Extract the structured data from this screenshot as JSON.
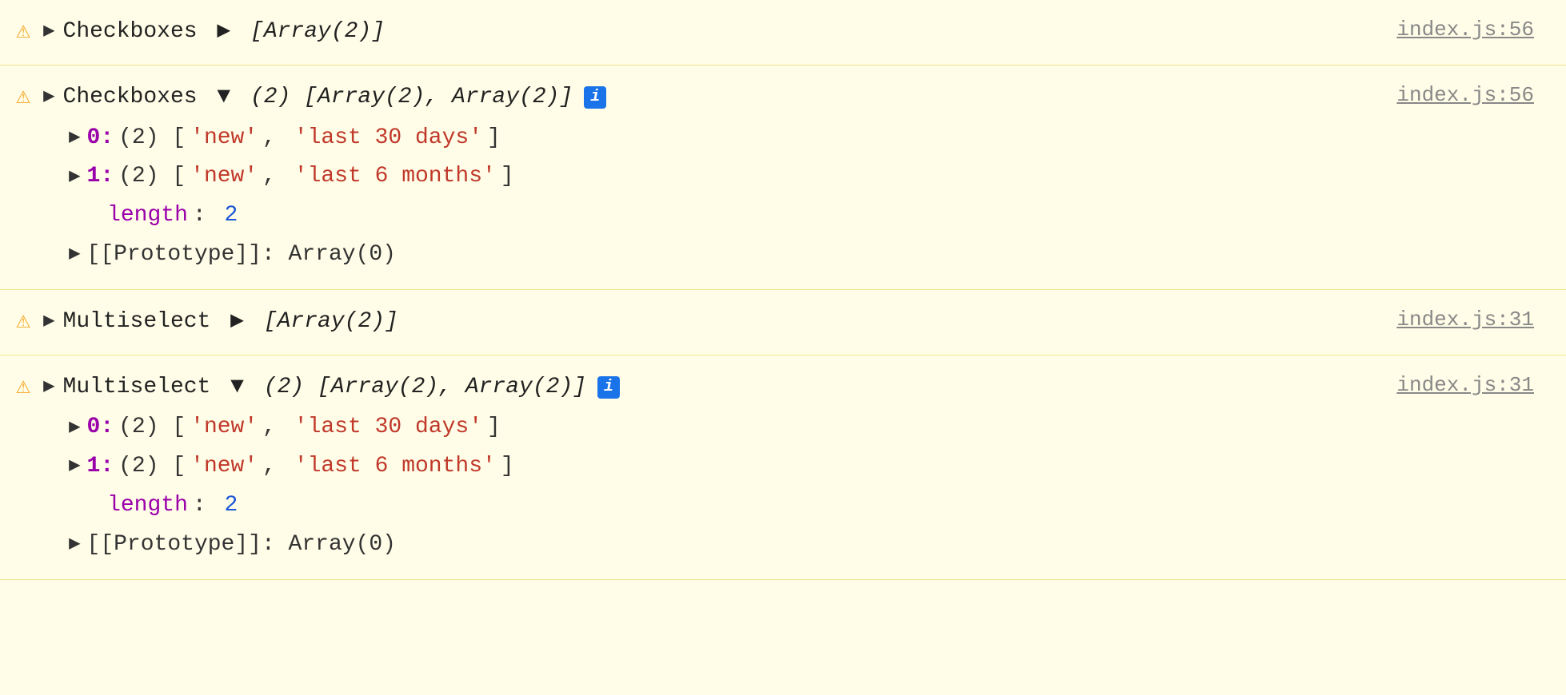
{
  "console": {
    "entries": [
      {
        "id": "entry-1",
        "hasWarning": true,
        "expanded": false,
        "label": "Checkboxes",
        "arrow": "▶",
        "arrayText": "[Array(2)]",
        "italic": true,
        "fileLink": "index.js:56"
      },
      {
        "id": "entry-2",
        "hasWarning": true,
        "expanded": true,
        "label": "Checkboxes",
        "arrow": "▼",
        "arrayCountText": "(2) [Array(2), Array(2)]",
        "italic": true,
        "hasInfoBadge": true,
        "fileLink": "index.js:56",
        "children": [
          {
            "type": "item",
            "indent": 1,
            "index": "0",
            "desc": "(2)",
            "values": [
              "'new'",
              "'last 30 days'"
            ]
          },
          {
            "type": "item",
            "indent": 1,
            "index": "1",
            "desc": "(2)",
            "values": [
              "'new'",
              "'last 6 months'"
            ]
          },
          {
            "type": "length",
            "indent": 2,
            "key": "length",
            "value": "2"
          },
          {
            "type": "proto",
            "indent": 1,
            "text": "[[Prototype]]: Array(0)"
          }
        ]
      },
      {
        "id": "entry-3",
        "hasWarning": true,
        "expanded": false,
        "label": "Multiselect",
        "arrow": "▶",
        "arrayText": "[Array(2)]",
        "italic": true,
        "fileLink": "index.js:31"
      },
      {
        "id": "entry-4",
        "hasWarning": true,
        "expanded": true,
        "label": "Multiselect",
        "arrow": "▼",
        "arrayCountText": "(2) [Array(2), Array(2)]",
        "italic": true,
        "hasInfoBadge": true,
        "fileLink": "index.js:31",
        "children": [
          {
            "type": "item",
            "indent": 1,
            "index": "0",
            "desc": "(2)",
            "values": [
              "'new'",
              "'last 30 days'"
            ]
          },
          {
            "type": "item",
            "indent": 1,
            "index": "1",
            "desc": "(2)",
            "values": [
              "'new'",
              "'last 6 months'"
            ]
          },
          {
            "type": "length",
            "indent": 2,
            "key": "length",
            "value": "2"
          },
          {
            "type": "proto",
            "indent": 1,
            "text": "[[Prototype]]: Array(0)"
          }
        ]
      }
    ]
  }
}
